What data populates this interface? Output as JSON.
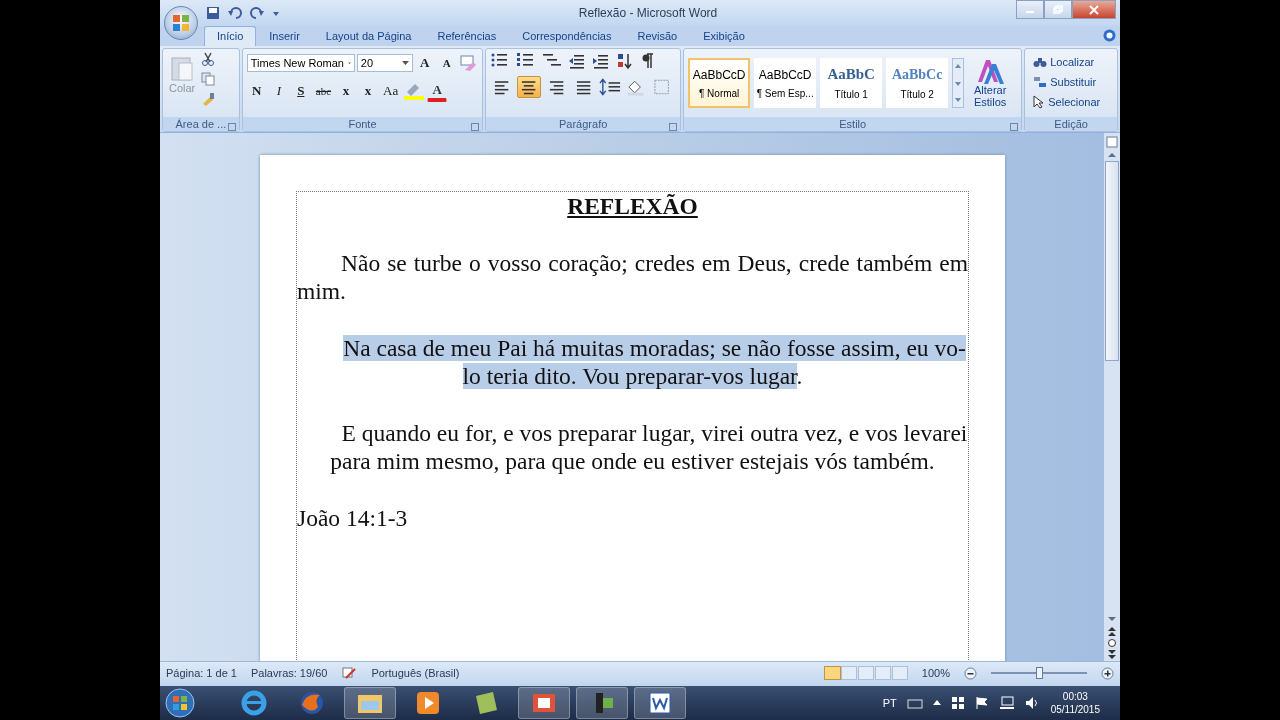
{
  "window": {
    "title": "Reflexão - Microsoft Word"
  },
  "tabs": [
    {
      "label": "Início",
      "selected": true
    },
    {
      "label": "Inserir",
      "selected": false
    },
    {
      "label": "Layout da Página",
      "selected": false
    },
    {
      "label": "Referências",
      "selected": false
    },
    {
      "label": "Correspondências",
      "selected": false
    },
    {
      "label": "Revisão",
      "selected": false
    },
    {
      "label": "Exibição",
      "selected": false
    }
  ],
  "ribbon": {
    "clipboard": {
      "label": "Área de ...",
      "paste": "Colar"
    },
    "font": {
      "label": "Fonte",
      "font_name": "Times New Roman",
      "font_size": "20",
      "grow": "A",
      "shrink": "A",
      "bold": "N",
      "italic": "I",
      "underline": "S",
      "strike": "abc",
      "subscript": "x",
      "superscript": "x",
      "case": "Aa",
      "color_letter": "A"
    },
    "paragraph": {
      "label": "Parágrafo",
      "alignment": [
        {
          "kind": "left",
          "selected": false
        },
        {
          "kind": "center",
          "selected": true
        },
        {
          "kind": "right",
          "selected": false
        },
        {
          "kind": "justify",
          "selected": false
        }
      ]
    },
    "styles": {
      "label": "Estilo",
      "items": [
        {
          "kind": "normal",
          "sample": "AaBbCcD",
          "name": "¶ Normal",
          "selected": true
        },
        {
          "kind": "normal",
          "sample": "AaBbCcD",
          "name": "¶ Sem Esp...",
          "selected": false
        },
        {
          "kind": "heading1",
          "sample": "AaBbC",
          "name": "Título 1",
          "selected": false
        },
        {
          "kind": "heading2",
          "sample": "AaBbCc",
          "name": "Título 2",
          "selected": false
        }
      ],
      "change": "Alterar Estilos"
    },
    "editing": {
      "label": "Edição",
      "items": [
        {
          "kind": "find",
          "label": "Localizar"
        },
        {
          "kind": "replace",
          "label": "Substituir"
        },
        {
          "kind": "select",
          "label": "Selecionar"
        }
      ]
    }
  },
  "document": {
    "title": "REFLEXÃO",
    "paragraphs": [
      {
        "kind": "justify",
        "runs": [
          {
            "text": "Não se turbe o vosso coração; credes em Deus, crede também em mim.",
            "selected": false
          }
        ]
      },
      {
        "kind": "center",
        "runs": [
          {
            "text": "Na casa de meu Pai há muitas moradas; se não fosse assim, eu vo-lo teria dito. Vou preparar-vos lugar",
            "selected": true
          },
          {
            "text": ".",
            "selected": false
          }
        ]
      },
      {
        "kind": "center",
        "runs": [
          {
            "text": "E quando eu for, e vos preparar lugar, virei outra vez, e vos levarei para mim mesmo, para que onde eu estiver estejais vós também.",
            "selected": false
          }
        ]
      },
      {
        "kind": "left",
        "runs": [
          {
            "text": "João 14:1-3",
            "selected": false
          }
        ]
      }
    ]
  },
  "status_bar": {
    "page": "Página: 1 de 1",
    "words": "Palavras: 19/60",
    "language": "Português (Brasil)",
    "zoom": "100%",
    "zoom_slider": {
      "level": 0.5
    }
  },
  "taskbar": {
    "language": "PT",
    "time": "00:03",
    "date": "05/11/2015"
  }
}
